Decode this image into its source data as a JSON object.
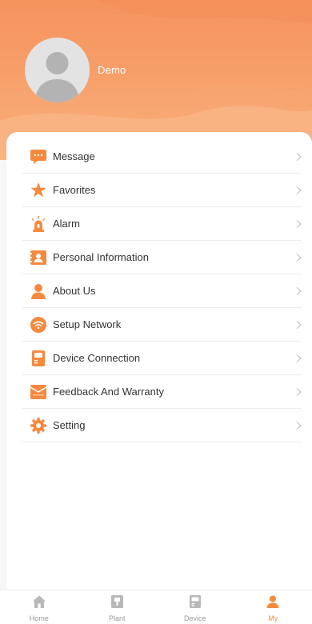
{
  "profile": {
    "user_name": "Demo"
  },
  "menu": {
    "items": [
      {
        "label": "Message",
        "icon": "message-icon"
      },
      {
        "label": "Favorites",
        "icon": "star-icon"
      },
      {
        "label": "Alarm",
        "icon": "alarm-icon"
      },
      {
        "label": "Personal Information",
        "icon": "id-card-icon"
      },
      {
        "label": "About Us",
        "icon": "person-icon"
      },
      {
        "label": "Setup Network",
        "icon": "wifi-icon"
      },
      {
        "label": "Device Connection",
        "icon": "device-icon"
      },
      {
        "label": "Feedback And Warranty",
        "icon": "feedback-icon"
      },
      {
        "label": "Setting",
        "icon": "gear-icon"
      }
    ]
  },
  "tabbar": {
    "tabs": [
      {
        "label": "Home",
        "icon": "home-icon",
        "active": false
      },
      {
        "label": "Plant",
        "icon": "plant-icon",
        "active": false
      },
      {
        "label": "Device",
        "icon": "device-tab-icon",
        "active": false
      },
      {
        "label": "My",
        "icon": "user-icon",
        "active": true
      }
    ]
  },
  "colors": {
    "accent": "#f58a3e",
    "header_top": "#f6935d",
    "header_bottom": "#f9b17c",
    "inactive_icon": "#b8b8b8"
  }
}
